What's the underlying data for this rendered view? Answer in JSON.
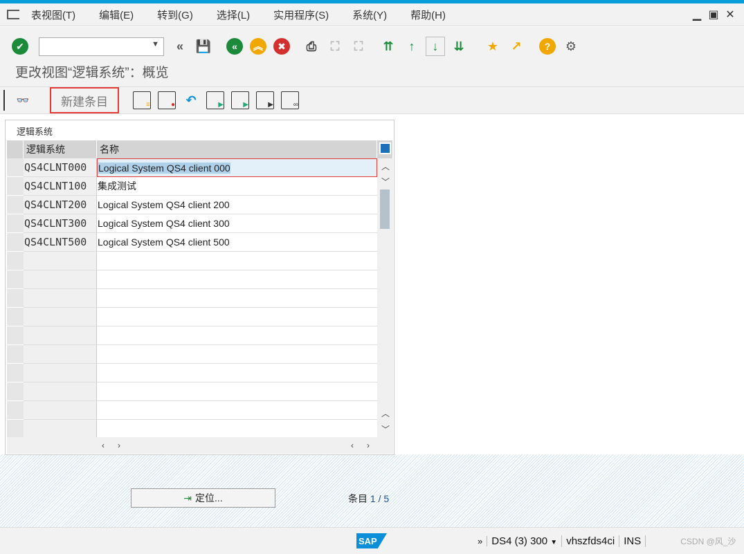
{
  "menu": [
    "表视图(T)",
    "编辑(E)",
    "转到(G)",
    "选择(L)",
    "实用程序(S)",
    "系统(Y)",
    "帮助(H)"
  ],
  "window_controls": [
    "minimize",
    "maximize",
    "close"
  ],
  "command_field": {
    "value": ""
  },
  "toolbar_icons": [
    "enter-check",
    "back-double",
    "save",
    "back",
    "exit",
    "cancel",
    "print",
    "find",
    "find-next",
    "first-page",
    "previous-page",
    "next-page",
    "last-page",
    "new-session",
    "shortcut",
    "help",
    "settings"
  ],
  "title": "更改视图“逻辑系统”：概览",
  "app_toolbar": {
    "new_entry": "新建条目",
    "icons": [
      "display-change",
      "copy",
      "delete",
      "undo",
      "select-all",
      "select-block",
      "deselect-all",
      "print-preview"
    ]
  },
  "table": {
    "caption": "逻辑系统",
    "columns": [
      "逻辑系统",
      "名称"
    ],
    "rows": [
      [
        "QS4CLNT000",
        "Logical System QS4 client 000"
      ],
      [
        "QS4CLNT100",
        "集成测试"
      ],
      [
        "QS4CLNT200",
        "Logical System QS4 client 200"
      ],
      [
        "QS4CLNT300",
        "Logical System QS4 client 300"
      ],
      [
        "QS4CLNT500",
        "Logical System QS4 client 500"
      ]
    ]
  },
  "position_button": "定位...",
  "entry_label": "条目",
  "entry_pos": "1 / 5",
  "status": {
    "system": "DS4 (3) 300",
    "server": "vhszfds4ci",
    "mode": "INS",
    "watermark": "CSDN @风_沙"
  },
  "colors": {
    "accent": "#0a9ddb",
    "highlight": "#e53935"
  }
}
